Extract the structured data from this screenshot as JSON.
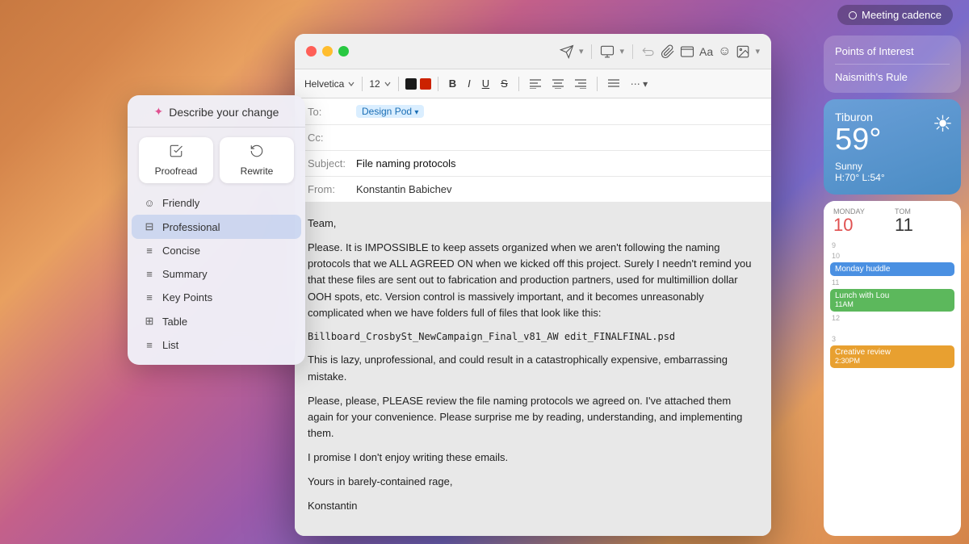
{
  "desktop": {
    "meeting_badge": "Meeting cadence"
  },
  "right_widgets": {
    "links": {
      "item1": "Points of Interest",
      "item2": "Naismith's Rule"
    },
    "weather": {
      "city": "Tiburon",
      "temp": "59°",
      "condition": "Sunny",
      "hi_lo": "H:70° L:54°"
    },
    "calendar": {
      "day_label_mon": "MONDAY",
      "day_num_mon": "10",
      "day_label_tom": "TOM",
      "events": [
        {
          "time": "10",
          "label": "Monday huddle",
          "right_num": "9",
          "color": "blue"
        },
        {
          "time": "11",
          "label": "Lunch with Lou",
          "sub": "11AM",
          "right_num": "10",
          "color": "green"
        },
        {
          "time": "3",
          "label": "Creative review",
          "sub": "2:30PM",
          "right_num": "",
          "color": "orange"
        }
      ]
    }
  },
  "email_window": {
    "to_label": "To:",
    "to_value": "Design Pod",
    "cc_label": "Cc:",
    "subject_label": "Subject:",
    "subject_value": "File naming protocols",
    "from_label": "From:",
    "from_value": "Konstantin Babichev",
    "toolbar": {
      "font_name": "Helvetica",
      "font_size": "12",
      "bold": "B",
      "italic": "I",
      "underline": "U",
      "strikethrough": "S"
    },
    "body": [
      "Team,",
      "Please. It is IMPOSSIBLE to keep assets organized when we aren't following the naming protocols that we ALL AGREED ON when we kicked off this project. Surely I needn't remind you that these files are sent out to fabrication and production partners, used for multimillion dollar OOH spots, etc. Version control is massively important, and it becomes unreasonably complicated when we have folders full of files that look like this:",
      "Billboard_CrosbySt_NewCampaign_Final_v81_AW edit_FINALFINAL.psd",
      "This is lazy, unprofessional, and could result in a catastrophically expensive, embarrassing mistake.",
      "Please, please, PLEASE review the file naming protocols we agreed on. I've attached them again for your convenience. Please surprise me by reading, understanding, and implementing them.",
      "I promise I don't enjoy writing these emails.",
      "Yours in barely-contained rage,",
      "Konstantin"
    ]
  },
  "ai_popup": {
    "header": "Describe your change",
    "proofread_label": "Proofread",
    "rewrite_label": "Rewrite",
    "menu_items": [
      {
        "id": "friendly",
        "icon": "☺",
        "label": "Friendly"
      },
      {
        "id": "professional",
        "icon": "⊟",
        "label": "Professional",
        "selected": true
      },
      {
        "id": "concise",
        "icon": "≡",
        "label": "Concise"
      },
      {
        "id": "summary",
        "icon": "≡",
        "label": "Summary"
      },
      {
        "id": "key_points",
        "icon": "≡",
        "label": "Key Points"
      },
      {
        "id": "table",
        "icon": "⊞",
        "label": "Table"
      },
      {
        "id": "list",
        "icon": "≡",
        "label": "List"
      }
    ]
  }
}
